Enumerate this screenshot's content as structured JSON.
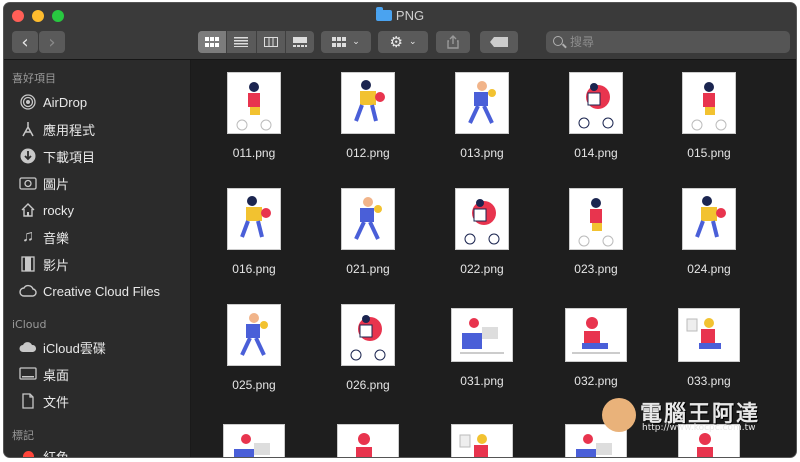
{
  "window": {
    "title": "PNG"
  },
  "toolbar": {
    "back": "‹",
    "forward": "›",
    "views": [
      "icon-view",
      "list-view",
      "column-view",
      "gallery-view"
    ],
    "group_icon": "grid-group-icon",
    "action_icon": "gear-icon",
    "share_icon": "share-icon",
    "tag_icon": "tag-icon",
    "search_placeholder": "搜尋"
  },
  "sidebar": {
    "favorites_title": "喜好項目",
    "favorites": [
      {
        "label": "AirDrop",
        "icon": "airdrop-icon"
      },
      {
        "label": "應用程式",
        "icon": "applications-icon"
      },
      {
        "label": "下載項目",
        "icon": "downloads-icon"
      },
      {
        "label": "圖片",
        "icon": "pictures-icon"
      },
      {
        "label": "rocky",
        "icon": "home-icon"
      },
      {
        "label": "音樂",
        "icon": "music-icon"
      },
      {
        "label": "影片",
        "icon": "movies-icon"
      },
      {
        "label": "Creative Cloud Files",
        "icon": "creative-cloud-icon"
      }
    ],
    "icloud_title": "iCloud",
    "icloud": [
      {
        "label": "iCloud雲碟",
        "icon": "icloud-drive-icon"
      },
      {
        "label": "桌面",
        "icon": "desktop-icon"
      },
      {
        "label": "文件",
        "icon": "documents-icon"
      }
    ],
    "tags_title": "標記",
    "tags": [
      {
        "label": "紅色",
        "color": "#ff453a"
      }
    ]
  },
  "files": [
    {
      "name": "011.png"
    },
    {
      "name": "012.png"
    },
    {
      "name": "013.png"
    },
    {
      "name": "014.png"
    },
    {
      "name": "015.png"
    },
    {
      "name": "016.png"
    },
    {
      "name": "021.png"
    },
    {
      "name": "022.png"
    },
    {
      "name": "023.png"
    },
    {
      "name": "024.png"
    },
    {
      "name": "025.png"
    },
    {
      "name": "026.png"
    },
    {
      "name": "031.png"
    },
    {
      "name": "032.png"
    },
    {
      "name": "033.png"
    },
    {
      "name": ""
    },
    {
      "name": ""
    },
    {
      "name": ""
    },
    {
      "name": ""
    },
    {
      "name": ""
    }
  ],
  "watermark": {
    "text": "電腦王阿達",
    "url": "http://www.kocpc.com.tw"
  },
  "colors": {
    "accent_blue": "#4aa3f0",
    "illus_red": "#e8344e",
    "illus_yellow": "#f2c230",
    "illus_blue": "#4a5fd8",
    "illus_navy": "#1b2550"
  }
}
